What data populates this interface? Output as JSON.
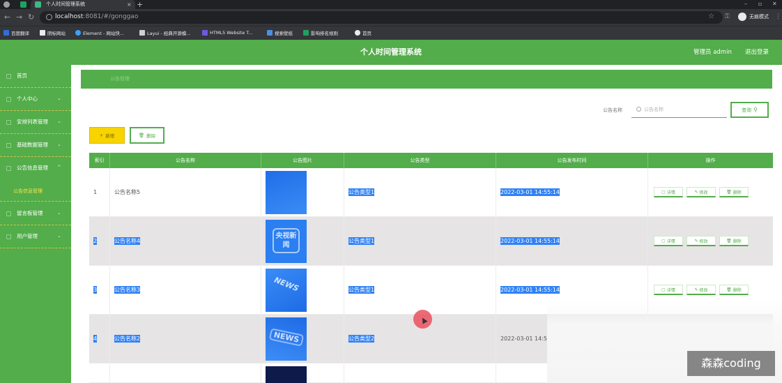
{
  "browser": {
    "tab_title": "个人时间管理系统",
    "new_tab": "+",
    "close": "×",
    "window_controls": [
      "–",
      "▫",
      "✕"
    ],
    "url_host": "localhost",
    "url_rest": ":8081/#/gonggao",
    "incognito_label": "无痕模式",
    "bookmarks": [
      "百度翻译",
      "阴标网站",
      "Element - 网站快...",
      "Layui - 经典开源模...",
      "HTML5 Website T...",
      "搜索壁纸",
      "影响排名规则",
      "首页"
    ]
  },
  "header": {
    "title": "个人时间管理系统",
    "admin": "管理员 admin",
    "logout": "退出登录"
  },
  "sidebar": {
    "items": [
      {
        "label": "首页",
        "chevron": ""
      },
      {
        "label": "个人中心",
        "chevron": "⌄"
      },
      {
        "label": "安排列表管理",
        "chevron": "⌄"
      },
      {
        "label": "基础数据管理",
        "chevron": "⌄"
      },
      {
        "label": "公告信息管理",
        "chevron": "^"
      },
      {
        "label": "公告信息管理",
        "chevron": "",
        "sub": true
      },
      {
        "label": "留言板管理",
        "chevron": "⌄"
      },
      {
        "label": "用户管理",
        "chevron": "⌄"
      }
    ]
  },
  "breadcrumb": "公告管理",
  "search": {
    "label": "公告名称",
    "placeholder": "公告名称",
    "button": "查询"
  },
  "actions": {
    "add": "新增",
    "delete": "删除"
  },
  "table": {
    "headers": [
      "索引",
      "公告名称",
      "公告图片",
      "公告类型",
      "公告发布时间",
      "操作"
    ],
    "ops": [
      "详情",
      "修改",
      "删除"
    ],
    "rows": [
      {
        "index": "1",
        "name": "公告名称5",
        "type": "公告类型1",
        "time": "2022-03-01 14:55:14",
        "img": ""
      },
      {
        "index": "2",
        "name": "公告名称4",
        "type": "公告类型1",
        "time": "2022-03-01 14:55:14",
        "img": "央视新闻"
      },
      {
        "index": "3",
        "name": "公告名称3",
        "type": "公告类型1",
        "time": "2022-03-01 14:55:14",
        "img": "NEWS"
      },
      {
        "index": "4",
        "name": "公告名称2",
        "type": "公告类型2",
        "time": "2022-03-01 14:5",
        "img": "NEWS"
      }
    ]
  },
  "watermark": "森森coding",
  "colors": {
    "primary": "#52ad4a",
    "add_button": "#f7d400",
    "selection": "#2f82f5",
    "chrome_dark": "#202124"
  }
}
